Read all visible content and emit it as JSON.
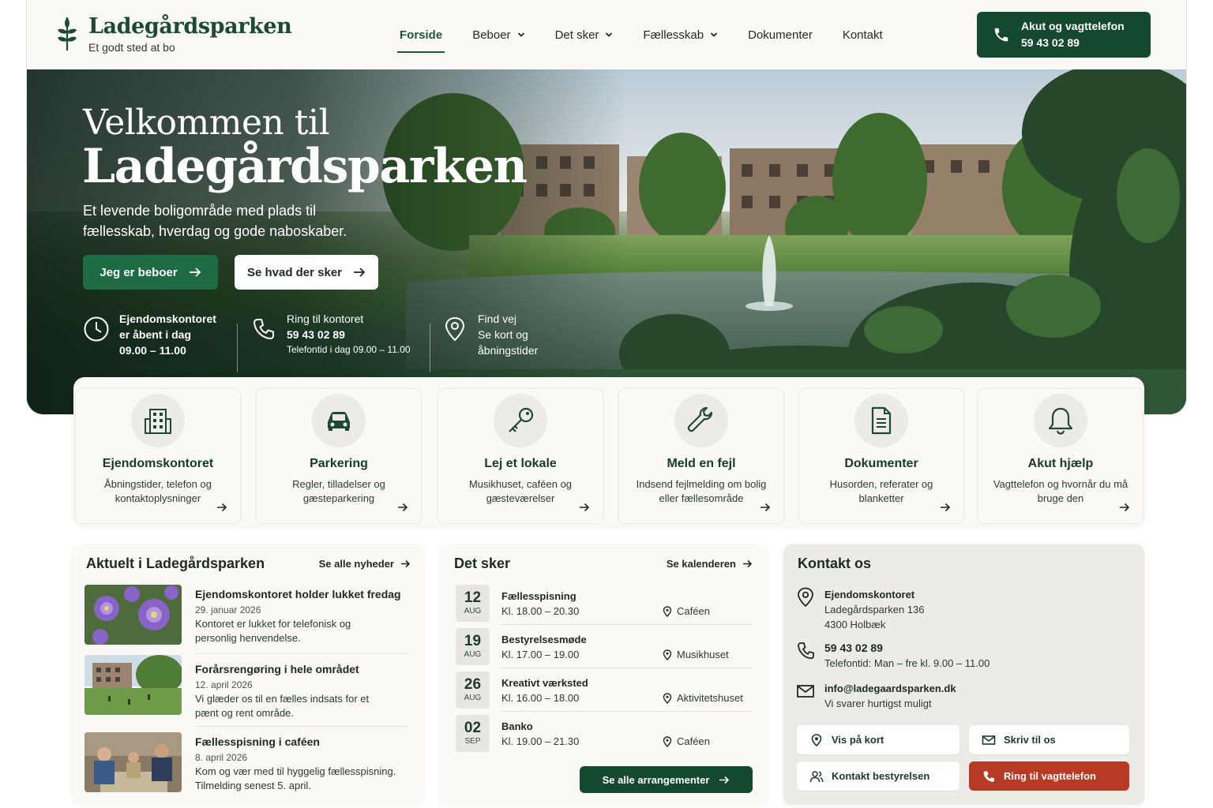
{
  "brand": {
    "name": "Ladegårdsparken",
    "tagline": "Et godt sted at bo"
  },
  "nav": [
    {
      "label": "Forside",
      "active": true,
      "dropdown": false
    },
    {
      "label": "Beboer",
      "dropdown": true
    },
    {
      "label": "Det sker",
      "dropdown": true
    },
    {
      "label": "Fællesskab",
      "dropdown": true
    },
    {
      "label": "Dokumenter",
      "dropdown": false
    },
    {
      "label": "Kontakt",
      "dropdown": false
    }
  ],
  "emergency": {
    "title": "Akut og vagttelefon",
    "phone": "59 43 02 89"
  },
  "hero": {
    "title_line1": "Velkommen til",
    "title_line2": "Ladegårdsparken",
    "lead": "Et levende boligområde med plads til fællesskab, hverdag og gode naboskaber.",
    "btn_primary": "Jeg er beboer",
    "btn_secondary": "Se hvad der sker",
    "info": [
      {
        "icon": "clock-icon",
        "line1": "Ejendomskontoret",
        "line2": "er åbent i dag",
        "line3": "09.00 – 11.00"
      },
      {
        "icon": "phone-icon",
        "line1": "Ring til kontoret",
        "line2": "59 43 02 89",
        "line3": "Telefontid i dag 09.00 – 11.00"
      },
      {
        "icon": "map-pin-icon",
        "line1": "Find vej",
        "line2": "Se kort og",
        "line3": "åbningstider"
      }
    ]
  },
  "cards": [
    {
      "icon": "building-icon",
      "title": "Ejendomskontoret",
      "desc": "Åbningstider, telefon og kontaktoplysninger"
    },
    {
      "icon": "car-icon",
      "title": "Parkering",
      "desc": "Regler, tilladelser og gæsteparkering"
    },
    {
      "icon": "key-icon",
      "title": "Lej et lokale",
      "desc": "Musikhuset, caféen og gæsteværelser"
    },
    {
      "icon": "wrench-icon",
      "title": "Meld en fejl",
      "desc": "Indsend fejlmelding om bolig eller fællesområde"
    },
    {
      "icon": "document-icon",
      "title": "Dokumenter",
      "desc": "Husorden, referater og blanketter"
    },
    {
      "icon": "bell-icon",
      "title": "Akut hjælp",
      "desc": "Vagttelefon og hvornår du må bruge den"
    }
  ],
  "news": {
    "title": "Aktuelt i Ladegårdsparken",
    "link": "Se alle nyheder",
    "items": [
      {
        "title": "Ejendomskontoret holder lukket fredag",
        "date": "29. januar 2026",
        "body1": "Kontoret er lukket for telefonisk og",
        "body2": "personlig henvendelse."
      },
      {
        "title": "Forårsrengøring i hele området",
        "date": "12. april 2026",
        "body1": "Vi glæder os til en fælles indsats for et",
        "body2": "pænt og rent område."
      },
      {
        "title": "Fællesspisning i caféen",
        "date": "8. april 2026",
        "body1": "Kom og vær med til hyggelig fællesspisning.",
        "body2": "Tilmelding senest 5. april."
      }
    ]
  },
  "events": {
    "title": "Det sker",
    "link": "Se kalenderen",
    "button": "Se alle arrangementer",
    "items": [
      {
        "day": "12",
        "month": "AUG",
        "title": "Fællesspisning",
        "time": "Kl. 18.00 – 20.30",
        "place": "Caféen"
      },
      {
        "day": "19",
        "month": "AUG",
        "title": "Bestyrelsesmøde",
        "time": "Kl. 17.00 – 19.00",
        "place": "Musikhuset"
      },
      {
        "day": "26",
        "month": "AUG",
        "title": "Kreativt værksted",
        "time": "Kl. 16.00 – 18.00",
        "place": "Aktivitetshuset"
      },
      {
        "day": "02",
        "month": "SEP",
        "title": "Banko",
        "time": "Kl. 19.00 – 21.30",
        "place": "Caféen"
      }
    ]
  },
  "contact": {
    "title": "Kontakt os",
    "office": {
      "name": "Ejendomskontoret",
      "address": "Ladegårdsparken 136",
      "city": "4300 Holbæk"
    },
    "phone": {
      "number": "59 43 02 89",
      "hours": "Telefontid: Man – fre kl. 9.00 – 11.00"
    },
    "email": {
      "address": "info@ladegaardsparken.dk",
      "note": "Vi svarer hurtigst muligt"
    },
    "buttons": {
      "map": "Vis på kort",
      "write": "Skriv til os",
      "board": "Kontakt bestyrelsen",
      "call": "Ring til vagttelefon"
    }
  },
  "colors": {
    "primary": "#14492f",
    "accent_green": "#1f6b43",
    "alert_red": "#b73a25",
    "background": "#faf9f5"
  }
}
